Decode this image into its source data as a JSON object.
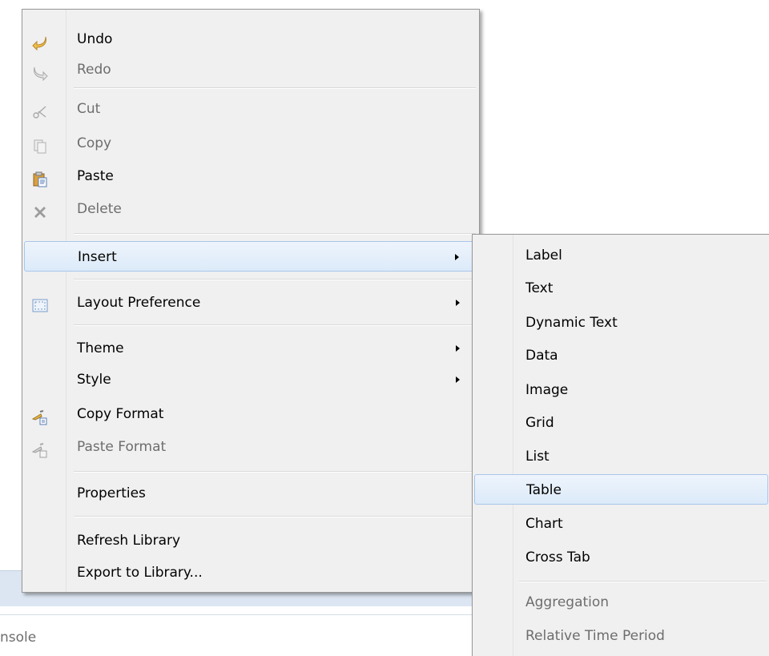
{
  "background": {
    "console_tab_label": "nsole"
  },
  "context_menu": {
    "items": [
      {
        "label": "Undo",
        "icon": "undo-icon",
        "enabled": true
      },
      {
        "label": "Redo",
        "icon": "redo-icon",
        "enabled": false
      },
      {
        "label": "Cut",
        "icon": "scissors-icon",
        "enabled": false
      },
      {
        "label": "Copy",
        "icon": "copy-icon",
        "enabled": false
      },
      {
        "label": "Paste",
        "icon": "clipboard-icon",
        "enabled": true
      },
      {
        "label": "Delete",
        "icon": "delete-x-icon",
        "enabled": false
      },
      {
        "label": "Insert",
        "submenu": true,
        "highlighted": true
      },
      {
        "label": "Layout Preference",
        "icon": "layout-frame-icon",
        "submenu": true
      },
      {
        "label": "Theme",
        "submenu": true
      },
      {
        "label": "Style",
        "submenu": true
      },
      {
        "label": "Copy Format",
        "icon": "copy-format-icon",
        "enabled": true
      },
      {
        "label": "Paste Format",
        "icon": "paste-format-icon",
        "enabled": false
      },
      {
        "label": "Properties"
      },
      {
        "label": "Refresh Library"
      },
      {
        "label": "Export to Library..."
      }
    ]
  },
  "insert_submenu": {
    "items": [
      {
        "label": "Label"
      },
      {
        "label": "Text"
      },
      {
        "label": "Dynamic Text"
      },
      {
        "label": "Data"
      },
      {
        "label": "Image"
      },
      {
        "label": "Grid"
      },
      {
        "label": "List"
      },
      {
        "label": "Table",
        "highlighted": true
      },
      {
        "label": "Chart"
      },
      {
        "label": "Cross Tab"
      },
      {
        "label": "Aggregation",
        "enabled": false
      },
      {
        "label": "Relative Time Period",
        "enabled": false
      }
    ]
  },
  "colors": {
    "menu_bg": "#f0f0f0",
    "highlight_border": "#a8c6ea",
    "disabled_text": "#6d6d6d",
    "icon_accent": "#e8b84a"
  }
}
